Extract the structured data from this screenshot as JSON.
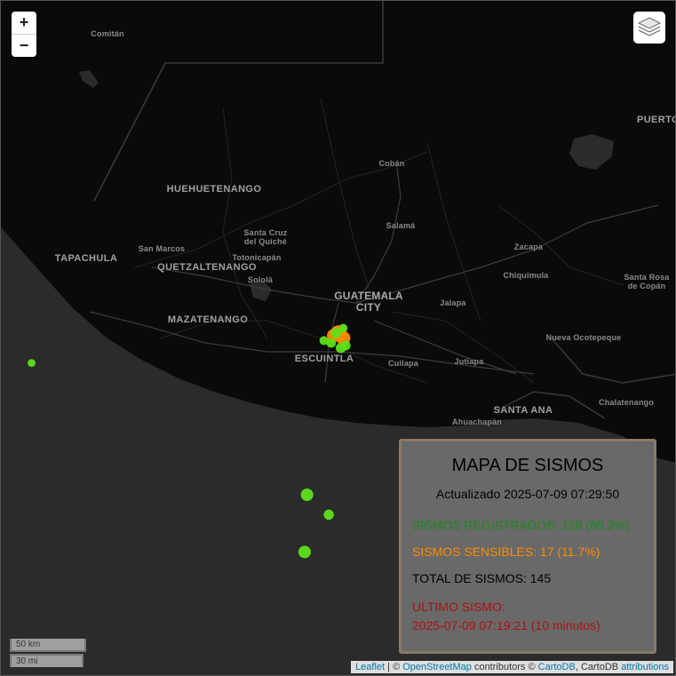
{
  "map": {
    "labels": {
      "comitan": "Comitán",
      "huehuetenango": "HUEHUETENANGO",
      "coban": "Cobán",
      "puerto": "PUERTO",
      "tapachula": "TAPACHULA",
      "san_marcos": "San Marcos",
      "santa_cruz": "Santa Cruz del Quiché",
      "salama": "Salamá",
      "quetzaltenango": "QUETZALTENANGO",
      "totonicapan": "Totonicapán",
      "zacapa": "Zacapa",
      "solola": "Sololá",
      "chiquimula": "Chiquimula",
      "santa_rosa_copan": "Santa Rosa de Copán",
      "guatemala_city": "GUATEMALA CITY",
      "jalapa": "Jalapa",
      "mazatenango": "MAZATENANGO",
      "nueva_ocotepeque": "Nueva Ocotepeque",
      "escuintla": "ESCUINTLA",
      "cuilapa": "Cuilapa",
      "jutiapa": "Jutiapa",
      "chalatenango": "Chalatenango",
      "ahuachapan": "Ahuachapán",
      "santa_ana": "SANTA ANA"
    },
    "quake_colors": {
      "registered": "#5de01a",
      "felt": "#ff8c00"
    },
    "quakes": [
      {
        "type": "felt",
        "lat": 14.45,
        "lon": -90.73,
        "mag": 4.0
      },
      {
        "type": "felt",
        "lat": 14.43,
        "lon": -90.71,
        "mag": 3.6
      },
      {
        "type": "felt",
        "lat": 14.44,
        "lon": -90.75,
        "mag": 3.4
      },
      {
        "type": "registered",
        "lat": 14.45,
        "lon": -90.74,
        "mag": 2.6
      },
      {
        "type": "registered",
        "lat": 14.41,
        "lon": -90.76,
        "mag": 2.4
      },
      {
        "type": "registered",
        "lat": 14.39,
        "lon": -90.72,
        "mag": 2.6
      },
      {
        "type": "registered",
        "lat": 14.47,
        "lon": -90.71,
        "mag": 2.2
      },
      {
        "type": "registered",
        "lat": 14.42,
        "lon": -90.79,
        "mag": 2.3
      },
      {
        "type": "registered",
        "lat": 14.4,
        "lon": -90.7,
        "mag": 2.5
      },
      {
        "type": "registered",
        "lat": 14.33,
        "lon": -92.0,
        "mag": 2.0
      },
      {
        "type": "registered",
        "lat": 13.8,
        "lon": -90.86,
        "mag": 3.2
      },
      {
        "type": "registered",
        "lat": 13.72,
        "lon": -90.77,
        "mag": 2.6
      },
      {
        "type": "registered",
        "lat": 13.57,
        "lon": -90.87,
        "mag": 3.2
      }
    ]
  },
  "controls": {
    "zoom_in": "+",
    "zoom_out": "−",
    "layers_icon": "layers-icon"
  },
  "scale": {
    "km": "50 km",
    "mi": "30 mi"
  },
  "attribution": {
    "leaflet": "Leaflet",
    "sep1": " | © ",
    "osm": "OpenStreetMap",
    "contrib": " contributors © ",
    "cartodb": "CartoDB",
    "sep2": ", CartoDB ",
    "attributions": "attributions"
  },
  "panel": {
    "title": "MAPA DE SISMOS",
    "updated": "Actualizado 2025-07-09 07:29:50",
    "registered": "SISMOS REGISTRADOS: 128 (88.3%)",
    "felt": "SISMOS SENSIBLES: 17 (11.7%)",
    "total": "TOTAL DE SISMOS: 145",
    "last_label": "ULTIMO SISMO:",
    "last_value": "2025-07-09 07:19:21 (10 minutos)"
  }
}
